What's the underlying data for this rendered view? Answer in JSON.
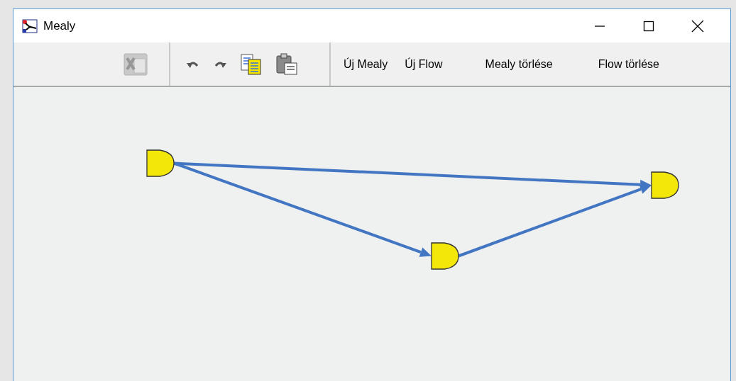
{
  "window": {
    "title": "Mealy"
  },
  "toolbar": {
    "icon_groups": [
      [
        {
          "kind": "excel",
          "disabled": true
        }
      ],
      [
        {
          "kind": "undo",
          "disabled": false
        },
        {
          "kind": "redo",
          "disabled": false
        },
        {
          "kind": "copy",
          "disabled": false
        },
        {
          "kind": "paste",
          "disabled": false
        }
      ]
    ],
    "text_buttons": [
      "Új Mealy",
      "Új Flow",
      "Mealy törlése",
      "Flow törlése"
    ]
  },
  "diagram": {
    "nodes": [
      {
        "kind": "gate"
      },
      {
        "kind": "gate"
      },
      {
        "kind": "gate"
      }
    ],
    "edges": [
      {
        "kind": "arrow"
      },
      {
        "kind": "arrow"
      },
      {
        "kind": "arrow"
      }
    ]
  }
}
